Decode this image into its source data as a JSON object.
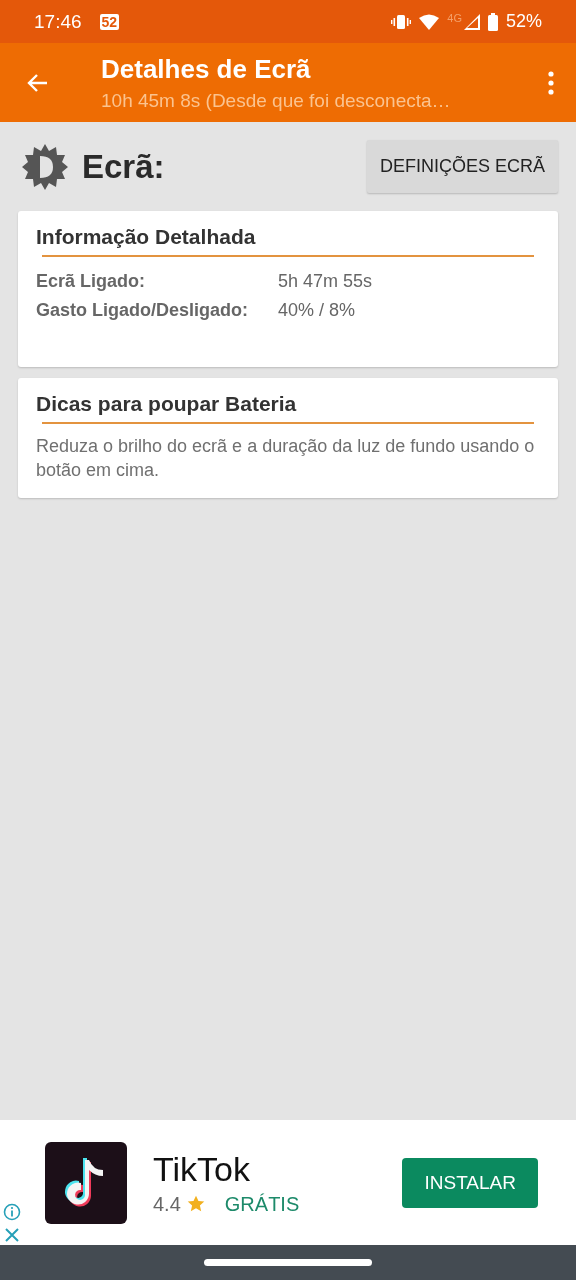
{
  "status_bar": {
    "time": "17:46",
    "notification_badge": "52",
    "network": "4G",
    "battery": "52%"
  },
  "app_bar": {
    "title": "Detalhes de Ecrã",
    "subtitle": "10h 45m 8s (Desde que foi desconecta…"
  },
  "header": {
    "title": "Ecrã:",
    "button": "DEFINIÇÕES ECRÃ"
  },
  "cards": [
    {
      "title": "Informação Detalhada",
      "kind": "table",
      "rows": [
        {
          "label": "Ecrã Ligado:",
          "value": "5h 47m 55s"
        },
        {
          "label": "Gasto Ligado/Desligado:",
          "value": "40% / 8%"
        }
      ]
    },
    {
      "title": "Dicas para poupar Bateria",
      "kind": "text",
      "text": "Reduza o brilho do ecrã e a duração da luz de fundo usando o botão em cima."
    }
  ],
  "ad": {
    "app_name": "TikTok",
    "rating": "4.4",
    "price": "GRÁTIS",
    "button": "INSTALAR"
  }
}
